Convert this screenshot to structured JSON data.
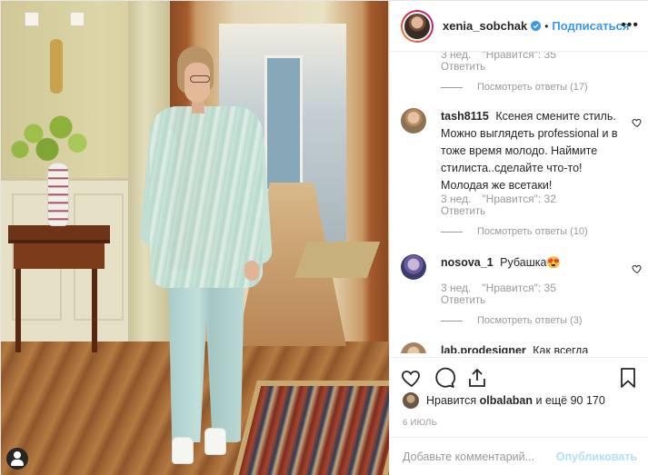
{
  "header": {
    "username": "xenia_sobchak",
    "separator": "•",
    "follow_label": "Подписаться",
    "more_label": "•••"
  },
  "comments": {
    "partial_top": {
      "time": "3 нед.",
      "likes": "\"Нравится\": 35",
      "reply": "Ответить",
      "view_replies": "Посмотреть ответы (17)"
    },
    "items": [
      {
        "username": "tash8115",
        "text": "Ксенея смените стиль. Можно выглядеть professional и в тоже время молодо. Наймите стилиста..сделайте что-то! Молодая же всетаки!",
        "time": "3 нед.",
        "likes": "\"Нравится\": 32",
        "reply": "Ответить",
        "view_replies": "Посмотреть ответы (10)"
      },
      {
        "username": "nosova_1",
        "text": "Рубашка😍",
        "time": "3 нед.",
        "likes": "\"Нравится\": 35",
        "reply": "Ответить",
        "view_replies": "Посмотреть ответы (3)"
      },
      {
        "username": "lab.prodesigner",
        "text": "Как всегда"
      }
    ]
  },
  "actions": {
    "like_icon": "heart-icon",
    "comment_icon": "comment-icon",
    "share_icon": "share-icon",
    "save_icon": "bookmark-icon"
  },
  "likes": {
    "prefix": "Нравится",
    "user": "olbalaban",
    "suffix": "и ещё 90 170"
  },
  "date": "6 ИЮЛЬ",
  "add_comment": {
    "placeholder": "Добавьте комментарий...",
    "publish_label": "Опубликовать"
  },
  "colors": {
    "link": "#3897f0",
    "publish_disabled": "#b2dffc",
    "muted": "#999999",
    "text": "#262626"
  }
}
